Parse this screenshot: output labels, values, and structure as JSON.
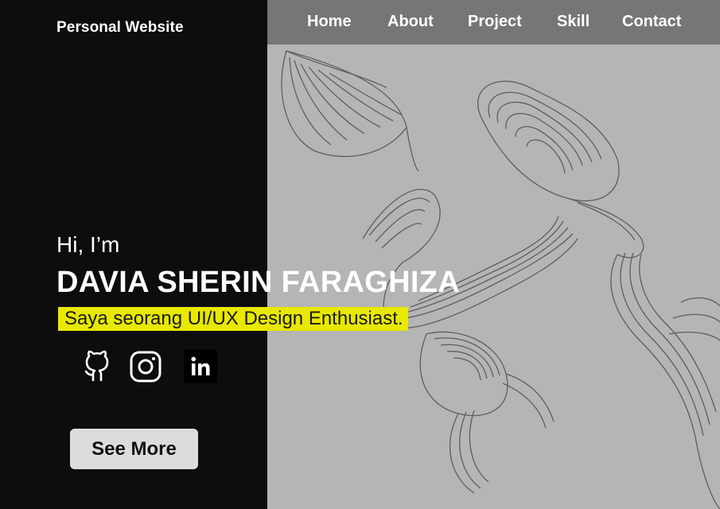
{
  "header": {
    "brand": "Personal Website",
    "nav": [
      "Home",
      "About",
      "Project",
      "Skill",
      "Contact"
    ]
  },
  "hero": {
    "greeting": "Hi, I’m",
    "name": "DAVIA SHERIN FARAGHIZA",
    "tagline": "Saya seorang UI/UX Design Enthusiast.",
    "social_icons": [
      "github-icon",
      "instagram-icon",
      "linkedin-icon"
    ],
    "cta_label": "See More"
  },
  "colors": {
    "left_panel": "#0d0d0d",
    "right_panel": "#b5b5b5",
    "navbar": "#767676",
    "highlight": "#e8e800",
    "button": "#dcdcdc"
  }
}
